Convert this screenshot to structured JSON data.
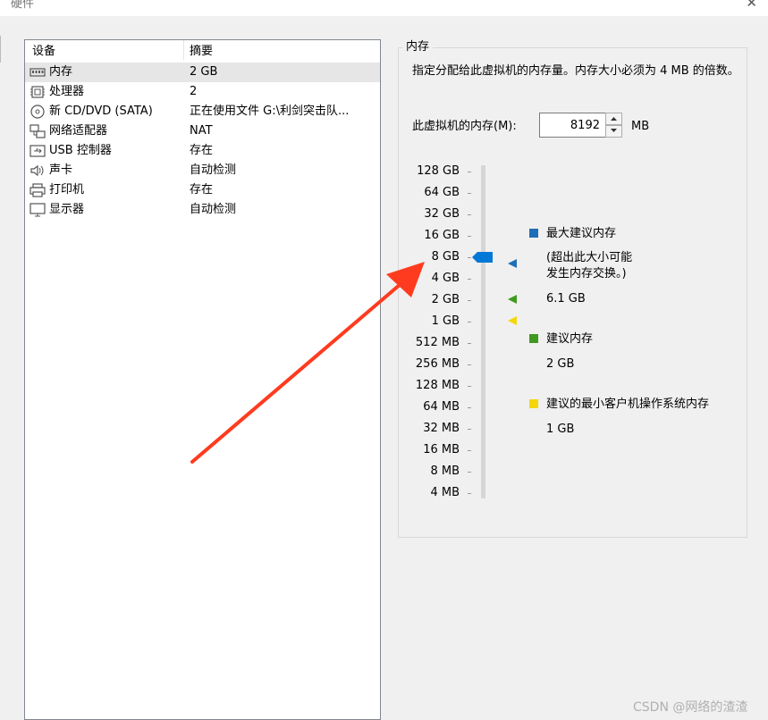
{
  "window": {
    "title": "硬件"
  },
  "device_list": {
    "headers": [
      "设备",
      "摘要"
    ],
    "items": [
      {
        "icon": "memory-icon",
        "name": "内存",
        "summary": "2 GB",
        "selected": true
      },
      {
        "icon": "processor-icon",
        "name": "处理器",
        "summary": "2"
      },
      {
        "icon": "cd-dvd-icon",
        "name": "新 CD/DVD (SATA)",
        "summary": "正在使用文件 G:\\利剑突击队..."
      },
      {
        "icon": "network-adapter-icon",
        "name": "网络适配器",
        "summary": "NAT"
      },
      {
        "icon": "usb-icon",
        "name": "USB 控制器",
        "summary": "存在"
      },
      {
        "icon": "sound-card-icon",
        "name": "声卡",
        "summary": "自动检测"
      },
      {
        "icon": "printer-icon",
        "name": "打印机",
        "summary": "存在"
      },
      {
        "icon": "display-icon",
        "name": "显示器",
        "summary": "自动检测"
      }
    ]
  },
  "memory": {
    "group_title": "内存",
    "description": "指定分配给此虚拟机的内存量。内存大小必须为 4 MB 的倍数。",
    "field_label": "此虚拟机的内存(M):",
    "field_value": "8192",
    "unit": "MB",
    "scale_labels": [
      "128 GB",
      "64 GB",
      "32 GB",
      "16 GB",
      "8 GB",
      "4 GB",
      "2 GB",
      "1 GB",
      "512 MB",
      "256 MB",
      "128 MB",
      "64 MB",
      "32 MB",
      "16 MB",
      "8 MB",
      "4 MB"
    ],
    "selected_scale_label": "8 GB",
    "legend": {
      "max_recommended": {
        "title": "最大建议内存",
        "note_line1": "(超出此大小可能",
        "note_line2": "发生内存交换。)",
        "value": "6.1 GB",
        "color": "#1e6fb8"
      },
      "recommended": {
        "title": "建议内存",
        "value": "2 GB",
        "color": "#3f9a1f"
      },
      "min_guest_os": {
        "title": "建议的最小客户机操作系统内存",
        "value": "1 GB",
        "color": "#f5d60a"
      }
    },
    "thumb_color": "#0078d7"
  },
  "annotation": {
    "arrow_color": "#ff3b1f"
  },
  "watermark": "CSDN @网络的渣渣"
}
